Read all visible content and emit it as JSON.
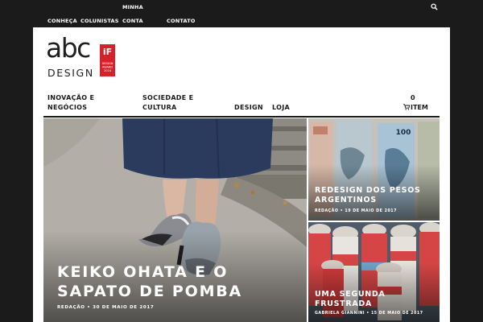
{
  "topbar": {
    "items": [
      "CONHEÇA",
      "COLUNISTAS",
      "CONTA",
      "CONTATO"
    ],
    "minha": "MINHA"
  },
  "brand": {
    "logo_text": "abc",
    "logo_subtext": "DESIGN",
    "badge_text": "DESIGN AWARD 2016",
    "badge_mark": "iF"
  },
  "mainnav": {
    "item1_line1": "INOVAÇÃO E",
    "item1_line2": "NEGÓCIOS",
    "item2_line1": "SOCIEDADE E",
    "item2_line2": "CULTURA",
    "item3": "DESIGN",
    "item4": "LOJA",
    "cart_count": "0",
    "cart_label": "ITEM"
  },
  "hero": {
    "title": "KEIKO OHATA E O SAPATO DE POMBA",
    "meta": "REDAÇÃO • 30 DE MAIO DE 2017"
  },
  "cards": [
    {
      "title": "REDESIGN DOS PESOS ARGENTINOS",
      "meta": "REDAÇÃO • 19 DE MAIO DE 2017"
    },
    {
      "title": "UMA SEGUNDA FRUSTRADA",
      "meta": "GABRIELA GIANNINI • 15 DE MAIO DE 2017"
    }
  ],
  "colors": {
    "topbar": "#1b1b1b",
    "brand_red": "#d6202a",
    "page": "#ffffff"
  }
}
